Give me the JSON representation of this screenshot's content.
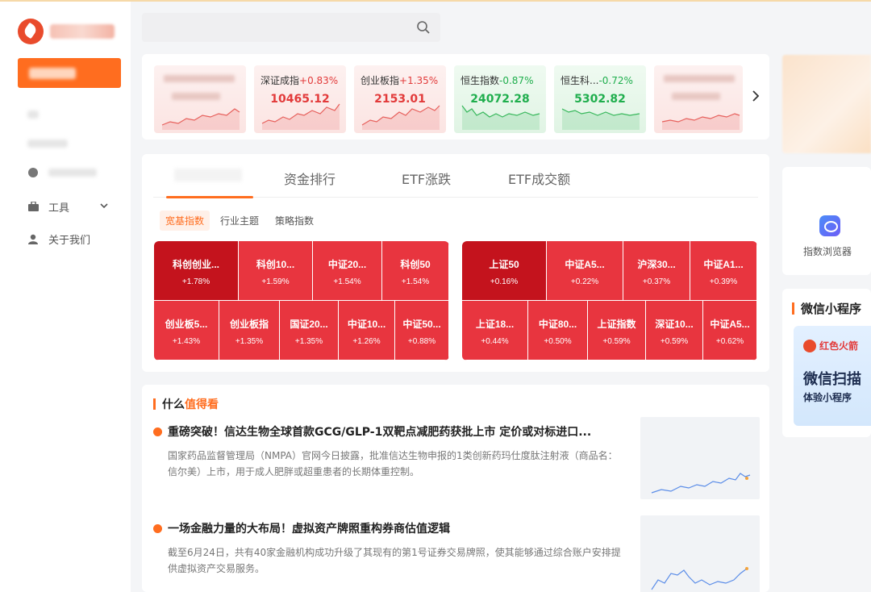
{
  "search": {
    "placeholder": ""
  },
  "sidebar": {
    "items": [
      {
        "label": "工具",
        "icon": "toolbox-icon"
      },
      {
        "label": "关于我们",
        "icon": "people-icon"
      }
    ]
  },
  "tickers": [
    {
      "name": "",
      "change": "",
      "value": "",
      "trend": "up",
      "blurred": true
    },
    {
      "name": "深证成指",
      "change": "+0.83%",
      "value": "10465.12",
      "trend": "up",
      "blurred": false
    },
    {
      "name": "创业板指",
      "change": "+1.35%",
      "value": "2153.01",
      "trend": "up",
      "blurred": false
    },
    {
      "name": "恒生指数",
      "change": "-0.87%",
      "value": "24072.28",
      "trend": "down",
      "blurred": false
    },
    {
      "name": "恒生科...",
      "change": "-0.72%",
      "value": "5302.82",
      "trend": "down",
      "blurred": false
    },
    {
      "name": "",
      "change": "",
      "value": "",
      "trend": "up",
      "blurred": true
    }
  ],
  "rankings": {
    "tabs": [
      "资金排行",
      "ETF涨跌",
      "ETF成交额"
    ],
    "subtabs": [
      "宽基指数",
      "行业主题",
      "策略指数"
    ],
    "left_top": [
      {
        "name": "科创创业...",
        "pct": "+1.78%"
      },
      {
        "name": "科创10...",
        "pct": "+1.59%"
      },
      {
        "name": "中证20...",
        "pct": "+1.54%"
      },
      {
        "name": "科创50",
        "pct": "+1.54%"
      }
    ],
    "left_bottom": [
      {
        "name": "创业板5...",
        "pct": "+1.43%"
      },
      {
        "name": "创业板指",
        "pct": "+1.35%"
      },
      {
        "name": "国证20...",
        "pct": "+1.35%"
      },
      {
        "name": "中证10...",
        "pct": "+1.26%"
      },
      {
        "name": "中证50...",
        "pct": "+0.88%"
      }
    ],
    "right_top": [
      {
        "name": "上证50",
        "pct": "+0.16%"
      },
      {
        "name": "中证A5...",
        "pct": "+0.22%"
      },
      {
        "name": "沪深30...",
        "pct": "+0.37%"
      },
      {
        "name": "中证A1...",
        "pct": "+0.39%"
      }
    ],
    "right_bottom": [
      {
        "name": "上证18...",
        "pct": "+0.44%"
      },
      {
        "name": "中证80...",
        "pct": "+0.50%"
      },
      {
        "name": "上证指数",
        "pct": "+0.59%"
      },
      {
        "name": "深证10...",
        "pct": "+0.59%"
      },
      {
        "name": "中证A5...",
        "pct": "+0.62%"
      }
    ]
  },
  "news": {
    "title_prefix": "什么",
    "title_highlight": "值得看",
    "items": [
      {
        "headline": "重磅突破！信达生物全球首款GCG/GLP-1双靶点减肥药获批上市 定价或对标进口...",
        "body": "国家药品监督管理局（NMPA）官网今日披露，批准信达生物申报的1类创新药玛仕度肽注射液（商品名：信尔美）上市，用于成人肥胖或超重患者的长期体重控制。"
      },
      {
        "headline": "一场金融力量的大布局！虚拟资产牌照重构券商估值逻辑",
        "body": "截至6月24日，共有40家金融机构成功升级了其现有的第1号证券交易牌照，使其能够通过综合账户安排提供虚拟资产交易服务。"
      }
    ]
  },
  "right": {
    "tool_label": "指数浏览器",
    "mini_title": "微信小程序",
    "mini_brand": "红色火箭",
    "mini_big": "微信扫描",
    "mini_small": "体验小程序"
  },
  "colors": {
    "accent": "#ff6d1f",
    "up": "#e23a3a",
    "down": "#1fae4d",
    "heat_deep": "#c4131d",
    "heat": "#e8353f"
  }
}
